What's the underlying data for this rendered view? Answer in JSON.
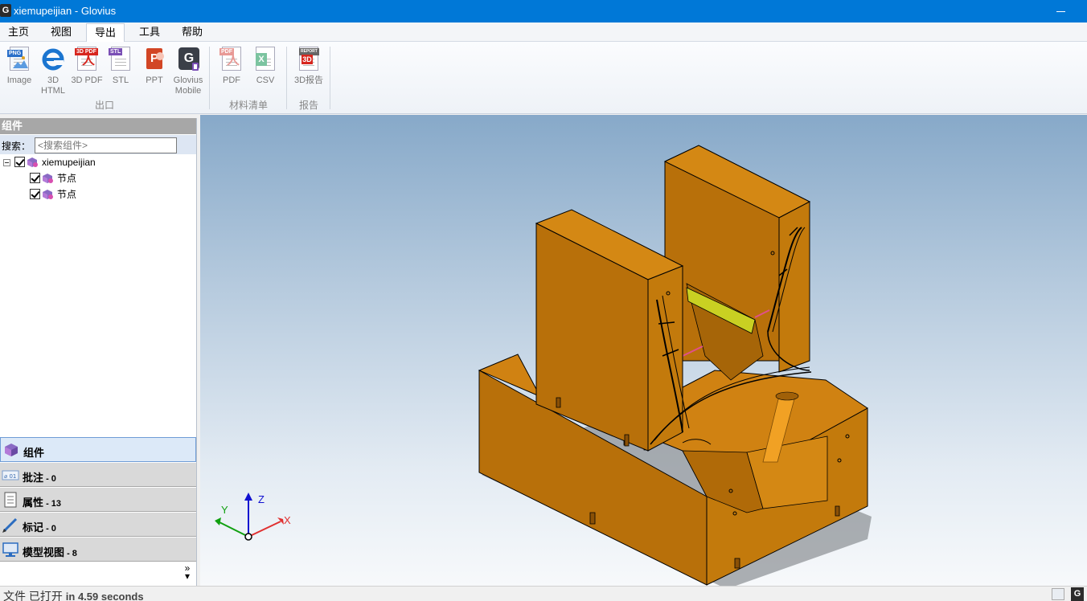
{
  "window": {
    "title": "xiemupeijian - Glovius",
    "app_icon": "G"
  },
  "menu": {
    "tabs": [
      {
        "label": "主页",
        "active": false
      },
      {
        "label": "视图",
        "active": false
      },
      {
        "label": "导出",
        "active": true
      },
      {
        "label": "工具",
        "active": false
      },
      {
        "label": "帮助",
        "active": false
      }
    ]
  },
  "ribbon": {
    "groups": [
      {
        "label": "出口",
        "buttons": [
          {
            "label": "Image",
            "icon": "png-image-icon"
          },
          {
            "label": "3D HTML",
            "icon": "ie-html-icon"
          },
          {
            "label": "3D PDF",
            "icon": "3d-pdf-icon"
          },
          {
            "label": "STL",
            "icon": "stl-file-icon"
          },
          {
            "label": "PPT",
            "icon": "powerpoint-icon"
          },
          {
            "label": "Glovius Mobile",
            "icon": "glovius-mobile-icon"
          }
        ]
      },
      {
        "label": "材料清单",
        "buttons": [
          {
            "label": "PDF",
            "icon": "pdf-icon"
          },
          {
            "label": "CSV",
            "icon": "csv-excel-icon"
          }
        ]
      },
      {
        "label": "报告",
        "buttons": [
          {
            "label": "3D报告",
            "icon": "3d-report-icon"
          }
        ]
      }
    ]
  },
  "left_panel": {
    "header": "组件",
    "search": {
      "label": "搜索：",
      "placeholder": "<搜索组件>"
    },
    "tree": {
      "root": {
        "label": "xiemupeijian",
        "checked": true,
        "expanded": true
      },
      "children": [
        {
          "label": "节点",
          "checked": true
        },
        {
          "label": "节点",
          "checked": true
        }
      ]
    },
    "accordion": [
      {
        "label": "组件",
        "count": "",
        "icon": "components-cube-icon",
        "active": true
      },
      {
        "label": "批注",
        "count": " - 0",
        "icon": "annotation-icon",
        "active": false
      },
      {
        "label": "属性",
        "count": " - 13",
        "icon": "properties-document-icon",
        "active": false
      },
      {
        "label": "标记",
        "count": " - 0",
        "icon": "markup-pen-icon",
        "active": false
      },
      {
        "label": "模型视图",
        "count": " - 8",
        "icon": "model-view-monitor-icon",
        "active": false
      }
    ],
    "more_symbol": "»"
  },
  "viewport": {
    "model_color": "#c87a0a",
    "axes": {
      "x": "X",
      "y": "Y",
      "z": "Z",
      "x_color": "#e03030",
      "y_color": "#10a010",
      "z_color": "#1010d0"
    }
  },
  "status": {
    "text": "文件 已打开",
    "time": "in 4.59 seconds"
  }
}
